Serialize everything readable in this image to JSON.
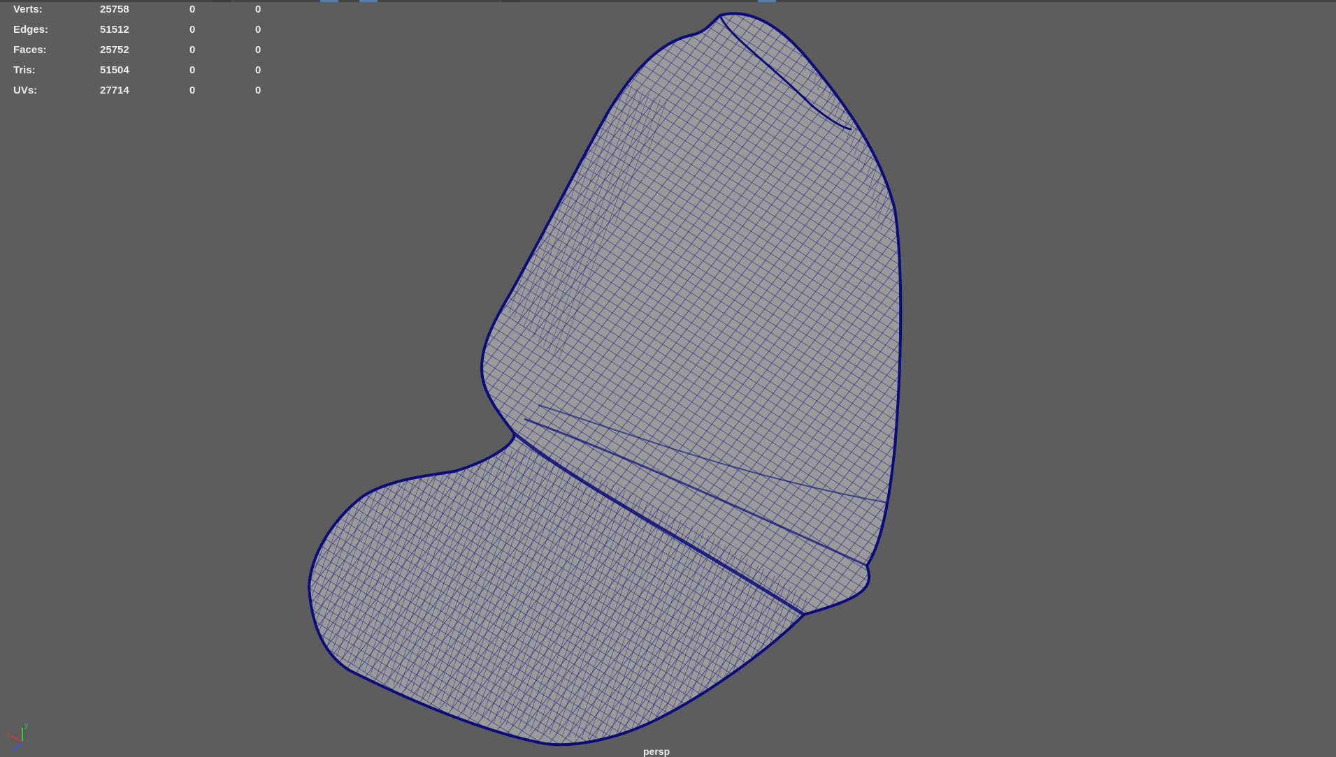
{
  "stats": [
    {
      "label": "Verts:",
      "values": [
        "25758",
        "0",
        "0"
      ]
    },
    {
      "label": "Edges:",
      "values": [
        "51512",
        "0",
        "0"
      ]
    },
    {
      "label": "Faces:",
      "values": [
        "25752",
        "0",
        "0"
      ]
    },
    {
      "label": "Tris:",
      "values": [
        "51504",
        "0",
        "0"
      ]
    },
    {
      "label": "UVs:",
      "values": [
        "27714",
        "0",
        "0"
      ]
    }
  ],
  "viewport": {
    "camera_label": "persp",
    "background_color": "#5d5d5d",
    "mesh_fill_color": "#9a9a9a",
    "wire_color": "#0c0c7a"
  },
  "axis": {
    "x": "x",
    "y": "y",
    "z": "z"
  },
  "icons": [
    "axis-gizmo-icon"
  ]
}
